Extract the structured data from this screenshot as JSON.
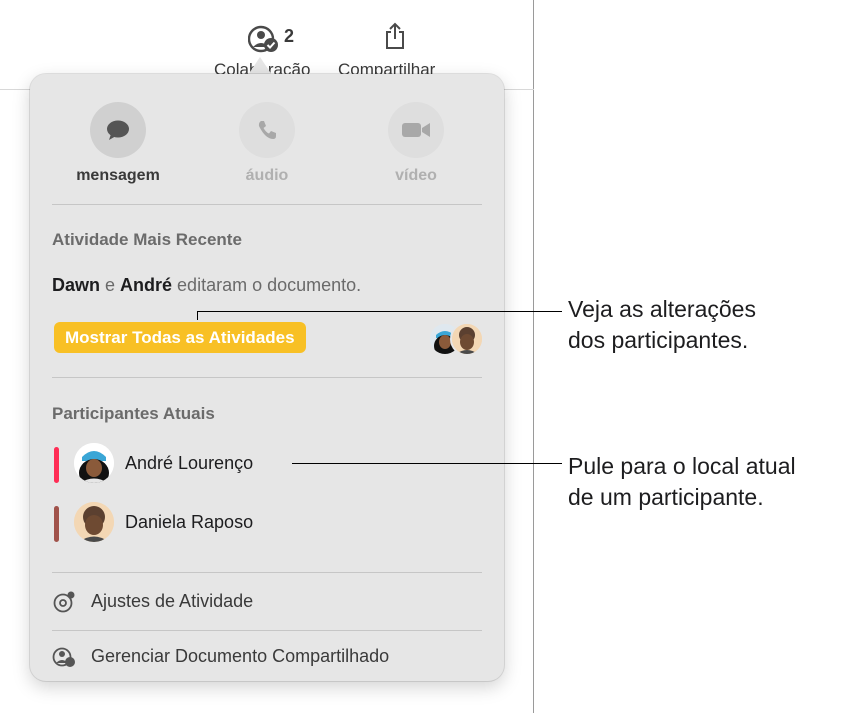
{
  "toolbar": {
    "collaboration_count": "2",
    "collaboration_label": "Colaboração",
    "share_label": "Compartilhar"
  },
  "contact_actions": [
    {
      "label": "mensagem",
      "icon": "message-bubble-icon",
      "enabled": true
    },
    {
      "label": "áudio",
      "icon": "phone-icon",
      "enabled": false
    },
    {
      "label": "vídeo",
      "icon": "video-camera-icon",
      "enabled": false
    }
  ],
  "recent_activity": {
    "title": "Atividade Mais Recente",
    "name1": "Dawn",
    "conj": " e ",
    "name2": "André",
    "rest": " editaram o documento.",
    "show_all_label": "Mostrar Todas as Atividades"
  },
  "participants": {
    "title": "Participantes Atuais",
    "items": [
      {
        "name": "André Lourenço",
        "color": "#ff2d55"
      },
      {
        "name": "Daniela Raposo",
        "color": "#a0524a"
      }
    ]
  },
  "menu": {
    "activity_settings": "Ajustes de Atividade",
    "manage_shared": "Gerenciar Documento Compartilhado"
  },
  "callouts": {
    "changes_line1": "Veja as alterações",
    "changes_line2": "dos participantes.",
    "jump_line1": "Pule para o local atual",
    "jump_line2": "de um participante."
  },
  "colors": {
    "accent": "#f8c025",
    "popover_bg": "#e6e6e6"
  }
}
